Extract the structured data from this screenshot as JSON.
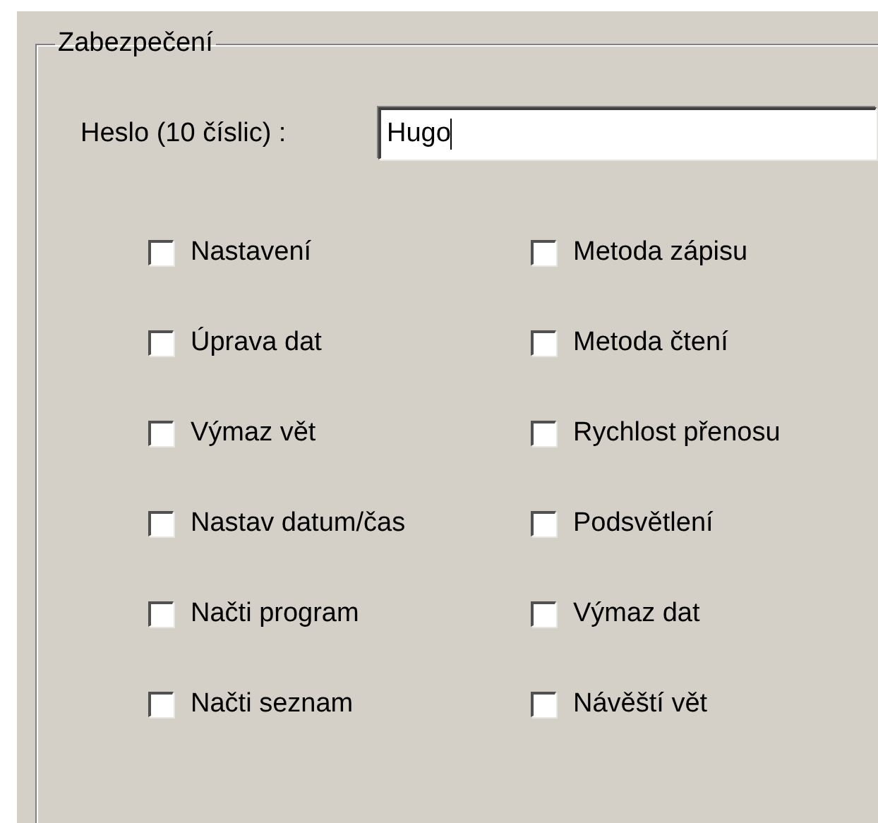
{
  "group": {
    "title": "Zabezpečení"
  },
  "password": {
    "label": "Heslo (10 číslic) :",
    "value": "Hugo",
    "focused": true
  },
  "options": [
    {
      "label": "Nastavení",
      "checked": false
    },
    {
      "label": "Metoda zápisu",
      "checked": false
    },
    {
      "label": "Úprava dat",
      "checked": false
    },
    {
      "label": "Metoda čtení",
      "checked": false
    },
    {
      "label": "Výmaz vět",
      "checked": false
    },
    {
      "label": "Rychlost přenosu",
      "checked": false
    },
    {
      "label": "Nastav datum/čas",
      "checked": false
    },
    {
      "label": "Podsvětlení",
      "checked": false
    },
    {
      "label": "Načti program",
      "checked": false
    },
    {
      "label": "Výmaz dat",
      "checked": false
    },
    {
      "label": "Načti seznam",
      "checked": false
    },
    {
      "label": "Návěští vět",
      "checked": false
    }
  ]
}
